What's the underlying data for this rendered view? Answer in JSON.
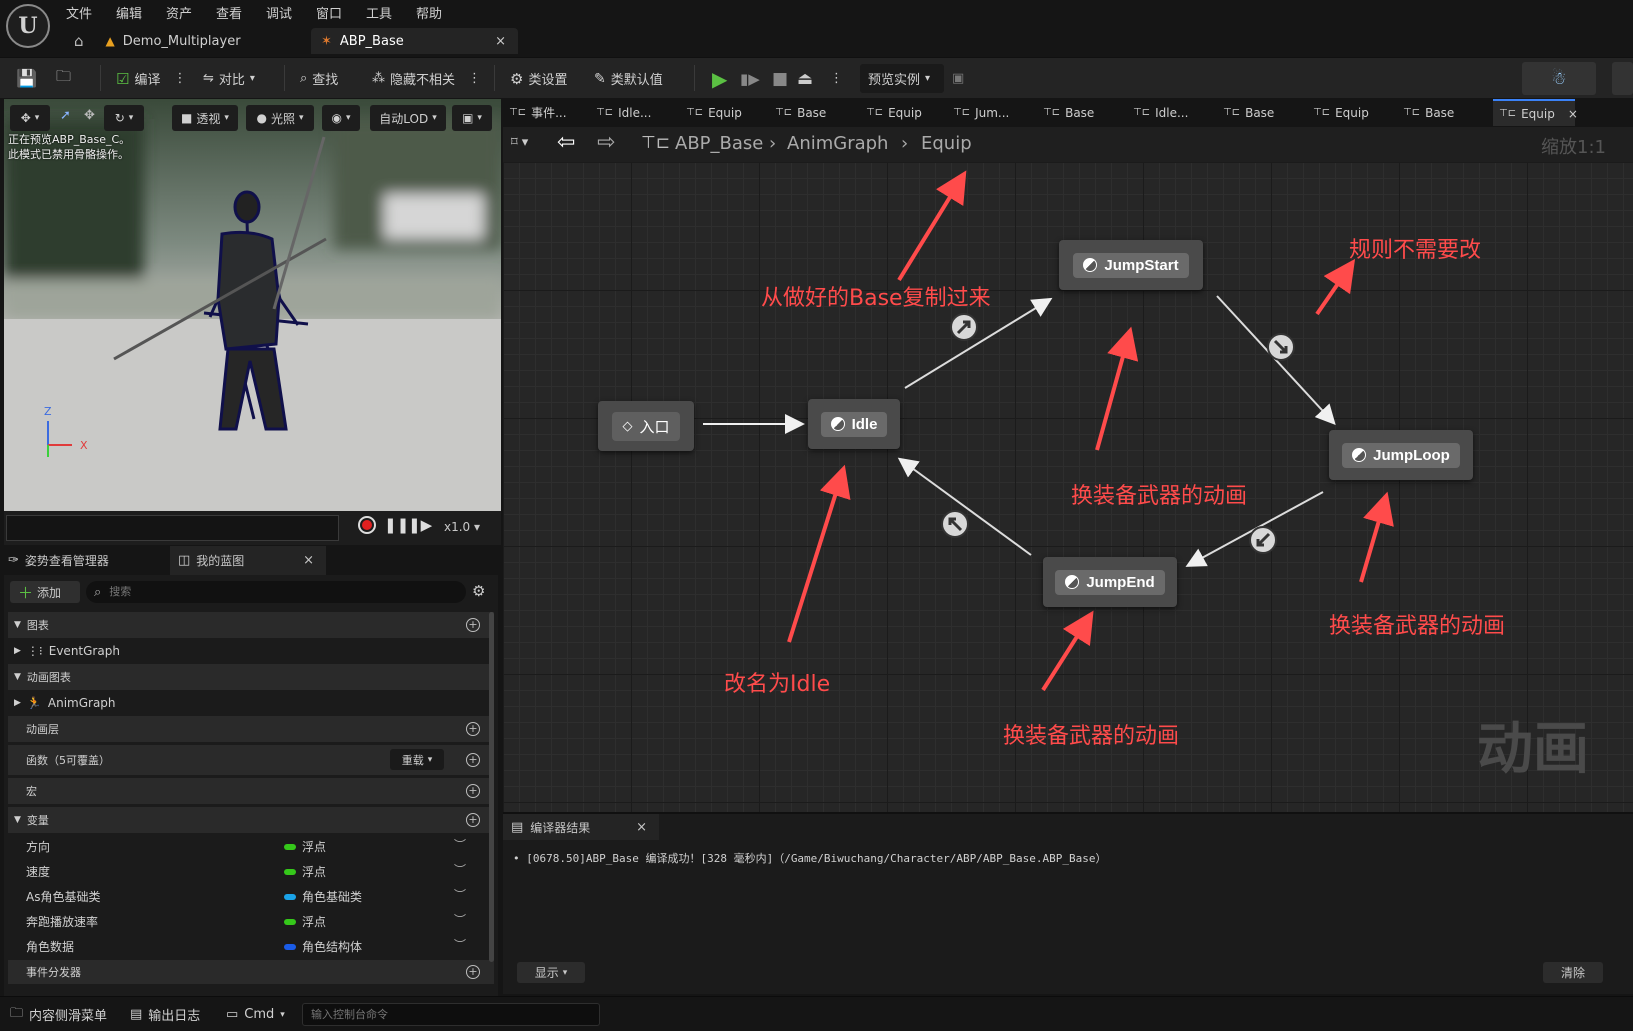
{
  "menu": [
    "文件",
    "编辑",
    "资产",
    "查看",
    "调试",
    "窗口",
    "工具",
    "帮助"
  ],
  "logo_text": "U",
  "doc_tabs": {
    "project": "Demo_Multiplayer",
    "asset": "ABP_Base",
    "close": "×"
  },
  "toolbar": {
    "compile": "编译",
    "diff": "对比",
    "find": "查找",
    "hide_unrelated": "隐藏不相关",
    "class_settings": "类设置",
    "class_defaults": "类默认值",
    "preview_instance": "预览实例"
  },
  "viewport": {
    "perspective": "透视",
    "lighting": "光照",
    "lod": "自动LOD",
    "overlay_line1": "正在预览ABP_Base_C。",
    "overlay_line2": "此模式已禁用骨骼操作。",
    "axis_z": "Z",
    "axis_x": "X",
    "speed": "x1.0"
  },
  "left_tabs": {
    "pose": "姿势查看管理器",
    "blueprint": "我的蓝图",
    "close": "×"
  },
  "left_panel": {
    "add": "添加",
    "search_placeholder": "搜索",
    "cat_graphs": "图表",
    "event_graph": "EventGraph",
    "cat_anim_graphs": "动画图表",
    "anim_graph": "AnimGraph",
    "cat_anim_layers": "动画层",
    "cat_functions": "函数（5可覆盖）",
    "override": "重载",
    "cat_macros": "宏",
    "cat_variables": "变量",
    "variables": [
      {
        "name": "方向",
        "type": "浮点",
        "color": "#35c81a"
      },
      {
        "name": "速度",
        "type": "浮点",
        "color": "#35c81a"
      },
      {
        "name": "As角色基础类",
        "type": "角色基础类",
        "color": "#1aa3e8"
      },
      {
        "name": "奔跑播放速率",
        "type": "浮点",
        "color": "#35c81a"
      },
      {
        "name": "角色数据",
        "type": "角色结构体",
        "color": "#1a5ce8"
      }
    ],
    "cat_dispatchers": "事件分发器"
  },
  "graph_tabs": [
    "事件...",
    "Idle...",
    "Equip",
    "Base",
    "Equip",
    "Jum...",
    "Base",
    "Idle...",
    "Base",
    "Equip",
    "Base",
    "Equip"
  ],
  "breadcrumb": {
    "root": "ABP_Base",
    "graph": "AnimGraph",
    "current": "Equip",
    "zoom": "缩放1:1"
  },
  "nodes": {
    "entry": "入口",
    "idle": "Idle",
    "jump_start": "JumpStart",
    "jump_loop": "JumpLoop",
    "jump_end": "JumpEnd"
  },
  "annotations": {
    "copy_from_base": "从做好的Base复制过来",
    "rules_unchanged": "规则不需要改",
    "anim_1": "换装备武器的动画",
    "anim_2": "换装备武器的动画",
    "anim_3": "换装备武器的动画",
    "rename_idle": "改名为Idle",
    "accent": "#ff4b4b"
  },
  "watermark": "动画",
  "compiler": {
    "tab": "编译器结果",
    "close": "×",
    "message": "[0678.50]ABP_Base 编译成功！[328 毫秒内]（/Game/Biwuchang/Character/ABP/ABP_Base.ABP_Base）",
    "show": "显示",
    "clear": "清除"
  },
  "statusbar": {
    "content_drawer": "内容侧滑菜单",
    "output_log": "输出日志",
    "cmd": "Cmd",
    "console_placeholder": "输入控制台命令"
  }
}
